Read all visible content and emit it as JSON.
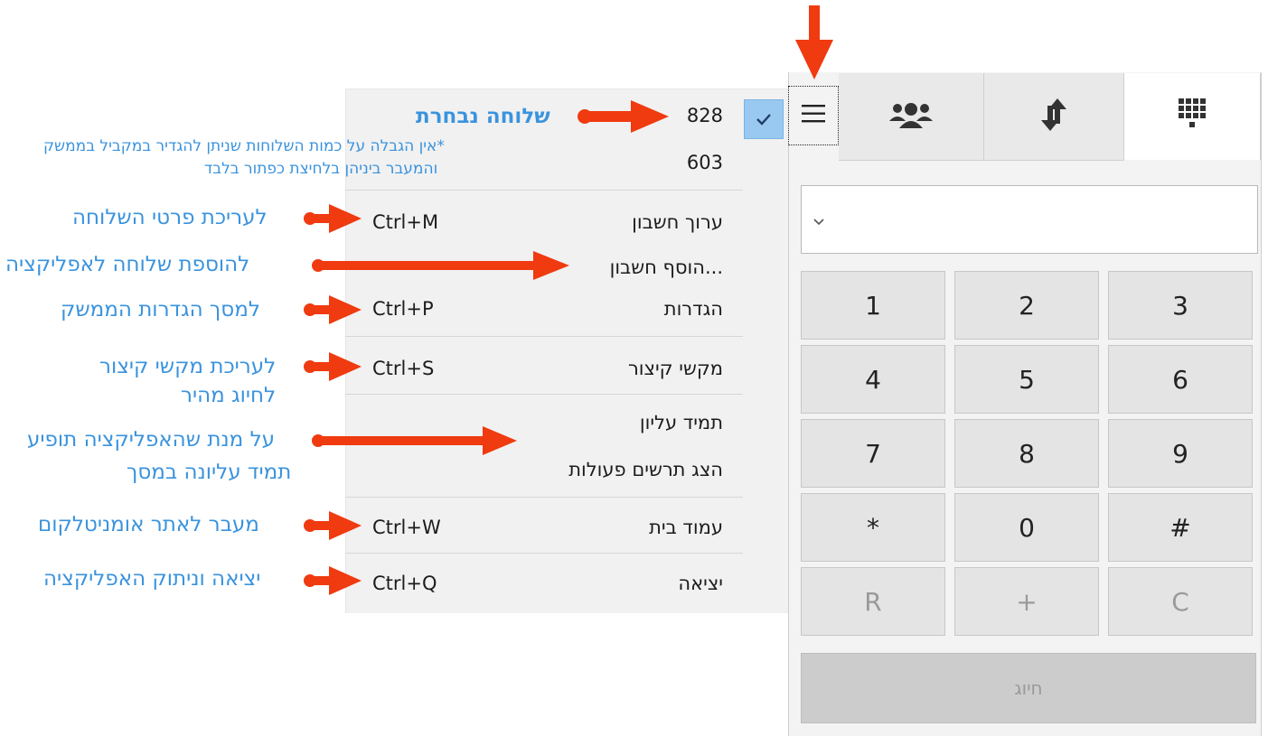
{
  "menu": {
    "accounts": [
      {
        "label": "828",
        "checked": true
      },
      {
        "label": "603",
        "checked": false
      }
    ],
    "items": [
      {
        "label": "ערוך חשבון",
        "shortcut": "Ctrl+M"
      },
      {
        "label": "הוסף חשבון...",
        "shortcut": ""
      },
      {
        "label": "הגדרות",
        "shortcut": "Ctrl+P"
      },
      {
        "label": "מקשי קיצור",
        "shortcut": "Ctrl+S"
      },
      {
        "label": "תמיד עליון",
        "shortcut": ""
      },
      {
        "label": "הצג תרשים פעולות",
        "shortcut": ""
      },
      {
        "label": "עמוד בית",
        "shortcut": "Ctrl+W"
      },
      {
        "label": "יציאה",
        "shortcut": "Ctrl+Q"
      }
    ]
  },
  "tabs": [
    {
      "icon": "menu-icon"
    },
    {
      "icon": "contacts-icon"
    },
    {
      "icon": "transfer-icon"
    },
    {
      "icon": "dialpad-icon"
    }
  ],
  "dialpad": {
    "keys": [
      "1",
      "2",
      "3",
      "4",
      "5",
      "6",
      "7",
      "8",
      "9",
      "*",
      "0",
      "#",
      "R",
      "+",
      "C"
    ],
    "call_label": "חיוג"
  },
  "annotations": {
    "selected_extension": "שלוחה נבחרת",
    "note_line1": "*אין הגבלה על כמות השלוחות שניתן להגדיר במקביל בממשק",
    "note_line2": "והמעבר ביניהן בלחיצת כפתור בלבד",
    "edit_extension": "לעריכת פרטי השלוחה",
    "add_extension": "להוספת שלוחה לאפליקציה",
    "settings_screen": "למסך הגדרות הממשק",
    "shortcuts_line1": "לעריכת מקשי קיצור",
    "shortcuts_line2": "לחיוג מהיר",
    "always_on_top_line1": "על מנת שהאפליקציה תופיע",
    "always_on_top_line2": "תמיד עליונה במסך",
    "homepage": "מעבר לאתר אומניטלקום",
    "exit": "יציאה וניתוק האפליקציה"
  },
  "colors": {
    "arrow": "#f03a10",
    "annotation_text": "#3a93dd",
    "check_highlight": "#99c9f0"
  }
}
